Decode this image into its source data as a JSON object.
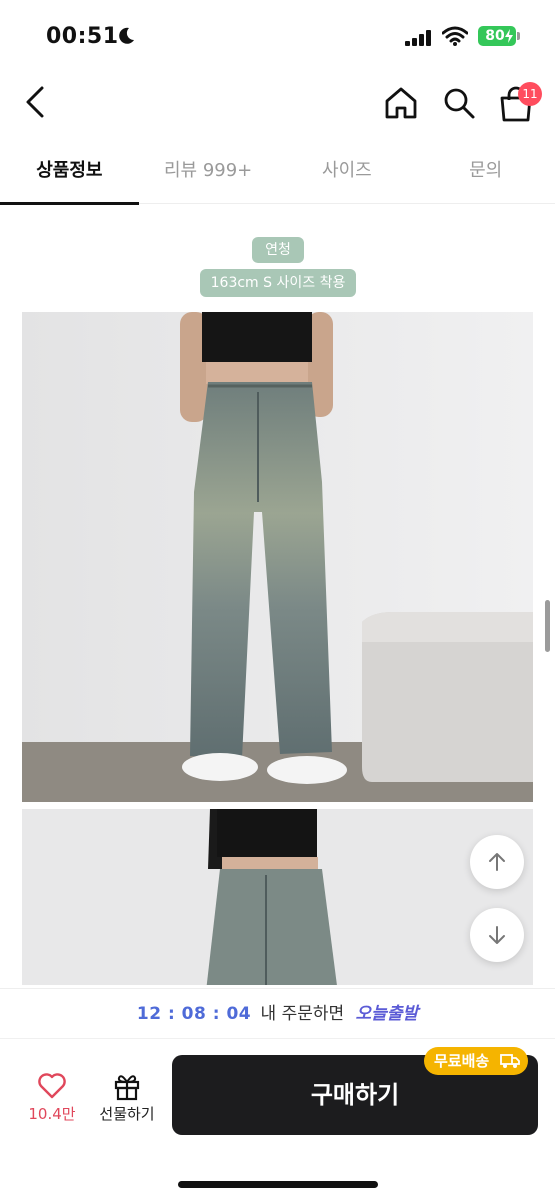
{
  "status_bar": {
    "time": "00:51",
    "battery": "80"
  },
  "nav": {
    "cart_count": "11"
  },
  "tabs": [
    {
      "label": "상품정보"
    },
    {
      "label": "리뷰 999+"
    },
    {
      "label": "사이즈"
    },
    {
      "label": "문의"
    }
  ],
  "content": {
    "color_chip": "연청",
    "size_chip": "163cm S 사이즈 착용"
  },
  "delivery": {
    "countdown": "12 : 08 : 04",
    "text": "내 주문하면",
    "highlight": "오늘출발"
  },
  "actions": {
    "like_count": "10.4만",
    "gift_label": "선물하기",
    "buy_label": "구매하기",
    "free_shipping": "무료배송"
  },
  "colors": {
    "accent_blue": "#4f6bd8",
    "chip_green": "#a9c7b6",
    "buy_button": "#1c1c1e",
    "free_ship_badge": "#f5b400",
    "like_red": "#e0475b",
    "cart_badge": "#ff4d5e"
  }
}
